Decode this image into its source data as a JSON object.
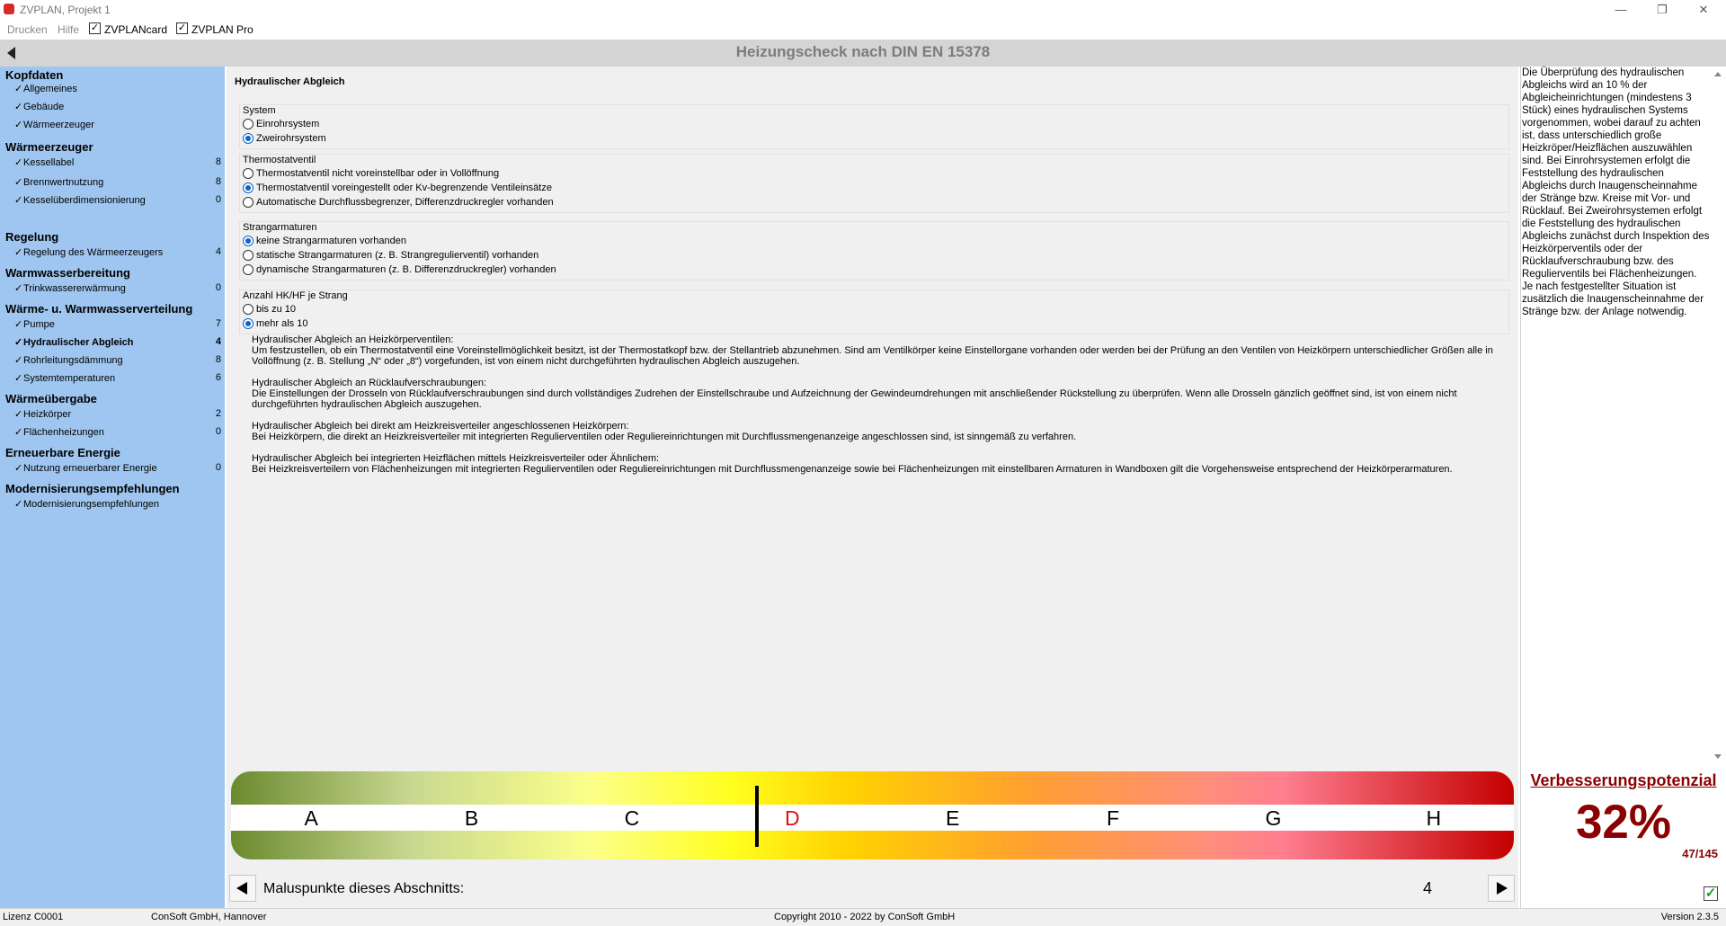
{
  "window": {
    "title": "ZVPLAN, Projekt 1",
    "minimize": "—",
    "maximize": "❐",
    "close": "✕"
  },
  "menu": {
    "print": "Drucken",
    "help": "Hilfe",
    "card": {
      "label": "ZVPLANcard",
      "checked": true
    },
    "pro": {
      "label": "ZVPLAN Pro",
      "checked": true
    }
  },
  "header": {
    "title": "Heizungscheck nach DIN EN 15378"
  },
  "sidebar": {
    "sections": [
      {
        "title": "Kopfdaten",
        "items": [
          {
            "label": "Allgemeines",
            "count": ""
          },
          {
            "label": "Gebäude",
            "count": ""
          },
          {
            "label": "Wärmeerzeuger",
            "count": ""
          }
        ]
      },
      {
        "title": "Wärmeerzeuger",
        "items": [
          {
            "label": "Kessellabel",
            "count": "8"
          },
          {
            "label": "Brennwertnutzung",
            "count": "8"
          },
          {
            "label": "Kesselüberdimensionierung",
            "count": "0"
          }
        ]
      },
      {
        "title": "Regelung",
        "items": [
          {
            "label": "Regelung des Wärmeerzeugers",
            "count": "4"
          }
        ]
      },
      {
        "title": "Warmwasserbereitung",
        "items": [
          {
            "label": "Trinkwassererwärmung",
            "count": "0"
          }
        ]
      },
      {
        "title": "Wärme- u. Warmwasserverteilung",
        "items": [
          {
            "label": "Pumpe",
            "count": "7"
          },
          {
            "label": "Hydraulischer Abgleich",
            "count": "4"
          },
          {
            "label": "Rohrleitungsdämmung",
            "count": "8"
          },
          {
            "label": "Systemtemperaturen",
            "count": "6"
          }
        ]
      },
      {
        "title": "Wärmeübergabe",
        "items": [
          {
            "label": "Heizkörper",
            "count": "2"
          },
          {
            "label": "Flächenheizungen",
            "count": "0"
          }
        ]
      },
      {
        "title": "Erneuerbare Energie",
        "items": [
          {
            "label": "Nutzung erneuerbarer Energie",
            "count": "0"
          }
        ]
      },
      {
        "title": "Modernisierungsempfehlungen",
        "items": [
          {
            "label": "Modernisierungsempfehlungen",
            "count": ""
          }
        ]
      }
    ],
    "check": "✓"
  },
  "main": {
    "title": "Hydraulischer Abgleich",
    "groups": [
      {
        "label": "System",
        "options": [
          {
            "text": "Einrohrsystem",
            "selected": false
          },
          {
            "text": "Zweirohrsystem",
            "selected": true
          }
        ]
      },
      {
        "label": "Thermostatventil",
        "options": [
          {
            "text": "Thermostatventil nicht voreinstellbar oder in Vollöffnung",
            "selected": false
          },
          {
            "text": "Thermostatventil voreingestellt oder Kv-begrenzende Ventileinsätze",
            "selected": true
          },
          {
            "text": "Automatische Durchflussbegrenzer, Differenzdruckregler vorhanden",
            "selected": false
          }
        ]
      },
      {
        "label": "Strangarmaturen",
        "options": [
          {
            "text": "keine Strangarmaturen vorhanden",
            "selected": true
          },
          {
            "text": "statische Strangarmaturen (z. B. Strangregulierventil) vorhanden",
            "selected": false
          },
          {
            "text": "dynamische Strangarmaturen (z. B. Differenzdruckregler) vorhanden",
            "selected": false
          }
        ]
      },
      {
        "label": "Anzahl HK/HF je Strang",
        "options": [
          {
            "text": "bis zu 10",
            "selected": false
          },
          {
            "text": "mehr als 10",
            "selected": true
          }
        ]
      }
    ],
    "info": [
      {
        "heading": "Hydraulischer Abgleich an Heizkörperventilen:",
        "body": "Um festzustellen, ob ein Thermostatventil eine Voreinstellmöglichkeit besitzt, ist der Thermostatkopf bzw. der Stellantrieb abzunehmen. Sind am Ventilkörper keine Einstellorgane vorhanden oder werden bei der Prüfung an den Ventilen von Heizkörpern unterschiedlicher Größen alle in Vollöffnung (z. B. Stellung „N“ oder „8“) vorgefunden, ist von einem nicht durchgeführten hydraulischen Abgleich auszugehen."
      },
      {
        "heading": "Hydraulischer Abgleich an Rücklaufverschraubungen:",
        "body": "Die Einstellungen der Drosseln von Rücklaufverschraubungen sind durch vollständiges Zudrehen der Einstellschraube und Aufzeichnung der Gewindeumdrehungen mit anschließender Rückstellung zu überprüfen. Wenn alle Drosseln gänzlich geöffnet sind, ist von einem nicht durchgeführten hydraulischen Abgleich auszugehen."
      },
      {
        "heading": "Hydraulischer Abgleich bei direkt am Heizkreisverteiler angeschlossenen Heizkörpern:",
        "body": "Bei Heizkörpern, die direkt an Heizkreisverteiler mit integrierten Regulierventilen oder Reguliereinrichtungen mit Durchflussmengenanzeige angeschlossen sind, ist sinngemäß zu verfahren."
      },
      {
        "heading": "Hydraulischer Abgleich bei integrierten Heizflächen mittels Heizkreisverteiler oder Ähnlichem:",
        "body": "Bei Heizkreisverteilern von Flächenheizungen mit integrierten Regulierventilen oder Reguliereinrichtungen mit Durchflussmengenanzeige sowie bei Flächenheizungen mit einstellbaren Armaturen in Wandboxen gilt die Vorgehensweise entsprechend der Heizkörperarmaturen."
      }
    ]
  },
  "help_text": "Die Überprüfung des hydraulischen Abgleichs wird an 10 % der Abgleicheinrichtungen (mindestens 3 Stück) eines hydraulischen Systems vorgenommen, wobei darauf zu achten ist, dass unterschiedlich große Heizkröper/Heizflächen auszuwählen sind. Bei Einrohrsystemen erfolgt die Feststellung des hydraulischen Abgleichs durch Inaugenscheinnahme der Stränge bzw. Kreise mit Vor- und Rücklauf. Bei Zweirohrsystemen erfolgt die Feststellung des hydraulischen Abgleichs zunächst durch Inspektion des Heizkörperventils oder der Rücklaufverschraubung bzw. des Regulierventils bei Flächenheizungen. Je nach festgestellter Situation ist zusätzlich die Inaugenscheinnahme der Stränge bzw. der Anlage notwendig.",
  "scale": {
    "letters": [
      "A",
      "B",
      "C",
      "D",
      "E",
      "F",
      "G",
      "H"
    ],
    "current": "D",
    "current_color": "#e01010",
    "marker_fraction": 0.41
  },
  "score": {
    "label": "Verbesserungspotenzial",
    "percent": "32%",
    "ratio": "47/145",
    "color": "#8b0000"
  },
  "bottom": {
    "malus_label": "Maluspunkte dieses Abschnitts:",
    "malus_value": "4"
  },
  "status": {
    "license": "Lizenz C0001",
    "company": "ConSoft GmbH, Hannover",
    "copyright": "Copyright 2010 - 2022 by ConSoft GmbH",
    "version": "Version 2.3.5"
  }
}
